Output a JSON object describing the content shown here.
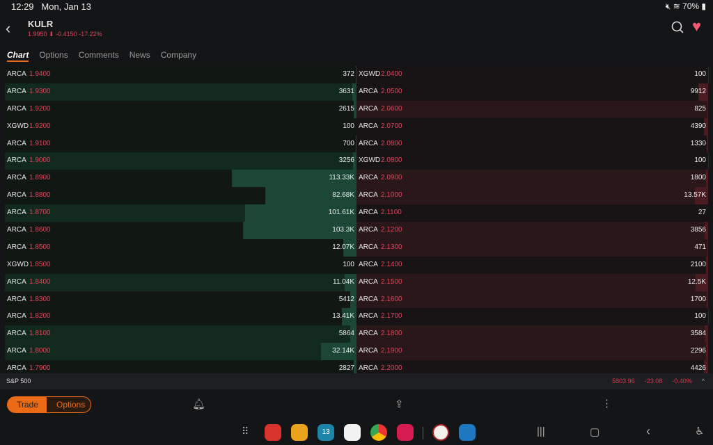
{
  "status": {
    "time": "12:29",
    "date": "Mon, Jan 13",
    "battery": "70%"
  },
  "header": {
    "symbol": "KULR",
    "price": "1.9950",
    "change": "-0.4150",
    "change_pct": "-17.22%"
  },
  "tabs": [
    "Chart",
    "Options",
    "Comments",
    "News",
    "Company"
  ],
  "bids": [
    {
      "ex": "ARCA",
      "px": "1.9400",
      "sz": "372",
      "size": 372,
      "t": 0
    },
    {
      "ex": "ARCA",
      "px": "1.9300",
      "sz": "3631",
      "size": 3631,
      "t": 1
    },
    {
      "ex": "ARCA",
      "px": "1.9200",
      "sz": "2615",
      "size": 2615,
      "t": 0
    },
    {
      "ex": "XGWD",
      "px": "1.9200",
      "sz": "100",
      "size": 100,
      "t": 0
    },
    {
      "ex": "ARCA",
      "px": "1.9100",
      "sz": "700",
      "size": 700,
      "t": 0
    },
    {
      "ex": "ARCA",
      "px": "1.9000",
      "sz": "3256",
      "size": 3256,
      "t": 1
    },
    {
      "ex": "ARCA",
      "px": "1.8900",
      "sz": "113.33K",
      "size": 113330,
      "t": 0
    },
    {
      "ex": "ARCA",
      "px": "1.8800",
      "sz": "82.68K",
      "size": 82680,
      "t": 0
    },
    {
      "ex": "ARCA",
      "px": "1.8700",
      "sz": "101.61K",
      "size": 101610,
      "t": 1
    },
    {
      "ex": "ARCA",
      "px": "1.8600",
      "sz": "103.3K",
      "size": 103300,
      "t": 0
    },
    {
      "ex": "ARCA",
      "px": "1.8500",
      "sz": "12.07K",
      "size": 12070,
      "t": 0
    },
    {
      "ex": "XGWD",
      "px": "1.8500",
      "sz": "100",
      "size": 100,
      "t": 0
    },
    {
      "ex": "ARCA",
      "px": "1.8400",
      "sz": "11.04K",
      "size": 11040,
      "t": 1
    },
    {
      "ex": "ARCA",
      "px": "1.8300",
      "sz": "5412",
      "size": 5412,
      "t": 0
    },
    {
      "ex": "ARCA",
      "px": "1.8200",
      "sz": "13.41K",
      "size": 13410,
      "t": 0
    },
    {
      "ex": "ARCA",
      "px": "1.8100",
      "sz": "5864",
      "size": 5864,
      "t": 1
    },
    {
      "ex": "ARCA",
      "px": "1.8000",
      "sz": "32.14K",
      "size": 32140,
      "t": 1
    },
    {
      "ex": "ARCA",
      "px": "1.7900",
      "sz": "2827",
      "size": 2827,
      "t": 0
    }
  ],
  "asks": [
    {
      "ex": "XGWD",
      "px": "2.0400",
      "sz": "100",
      "size": 100,
      "t": 0
    },
    {
      "ex": "ARCA",
      "px": "2.0500",
      "sz": "9912",
      "size": 9912,
      "t": 0
    },
    {
      "ex": "ARCA",
      "px": "2.0600",
      "sz": "825",
      "size": 825,
      "t": 1
    },
    {
      "ex": "ARCA",
      "px": "2.0700",
      "sz": "4390",
      "size": 4390,
      "t": 0
    },
    {
      "ex": "ARCA",
      "px": "2.0800",
      "sz": "1330",
      "size": 1330,
      "t": 0
    },
    {
      "ex": "XGWD",
      "px": "2.0800",
      "sz": "100",
      "size": 100,
      "t": 0
    },
    {
      "ex": "ARCA",
      "px": "2.0900",
      "sz": "1800",
      "size": 1800,
      "t": 1
    },
    {
      "ex": "ARCA",
      "px": "2.1000",
      "sz": "13.57K",
      "size": 13570,
      "t": 1
    },
    {
      "ex": "ARCA",
      "px": "2.1100",
      "sz": "27",
      "size": 27,
      "t": 0
    },
    {
      "ex": "ARCA",
      "px": "2.1200",
      "sz": "3856",
      "size": 3856,
      "t": 1
    },
    {
      "ex": "ARCA",
      "px": "2.1300",
      "sz": "471",
      "size": 471,
      "t": 1
    },
    {
      "ex": "ARCA",
      "px": "2.1400",
      "sz": "2100",
      "size": 2100,
      "t": 0
    },
    {
      "ex": "ARCA",
      "px": "2.1500",
      "sz": "12.5K",
      "size": 12500,
      "t": 1
    },
    {
      "ex": "ARCA",
      "px": "2.1600",
      "sz": "1700",
      "size": 1700,
      "t": 1
    },
    {
      "ex": "ARCA",
      "px": "2.1700",
      "sz": "100",
      "size": 100,
      "t": 0
    },
    {
      "ex": "ARCA",
      "px": "2.1800",
      "sz": "3584",
      "size": 3584,
      "t": 1
    },
    {
      "ex": "ARCA",
      "px": "2.1900",
      "sz": "2296",
      "size": 2296,
      "t": 1
    },
    {
      "ex": "ARCA",
      "px": "2.2000",
      "sz": "4426",
      "size": 4426,
      "t": 0
    }
  ],
  "index": {
    "name": "S&P 500",
    "value": "5803.96",
    "change": "-23.08",
    "change_pct": "-0.40%"
  },
  "actions": {
    "trade": "Trade",
    "options": "Options"
  },
  "dock_apps": [
    "flipboard",
    "files",
    "calendar",
    "messages",
    "chrome",
    "camera",
    "merriam-webster",
    "network"
  ],
  "calendar_day": "13"
}
